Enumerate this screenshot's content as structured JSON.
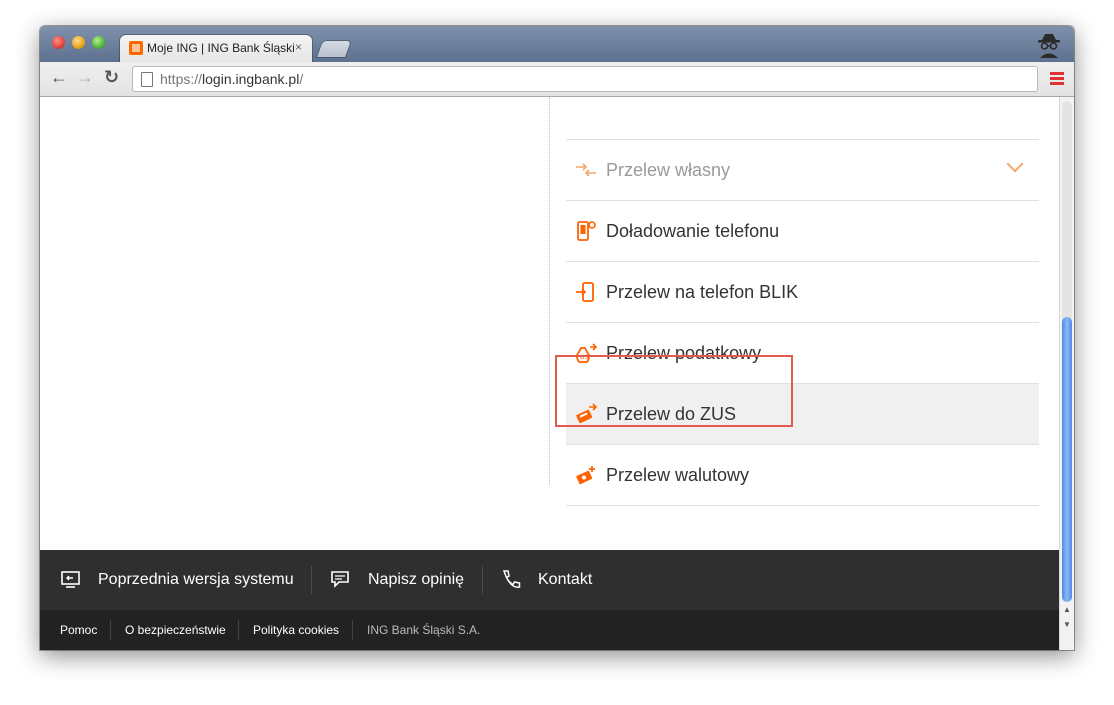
{
  "browser": {
    "tab_title": "Moje ING | ING Bank Śląski",
    "tab_close": "×",
    "url_scheme": "https://",
    "url_host": "login.ingbank.pl",
    "url_path": "/"
  },
  "menu": {
    "items": [
      {
        "label": "Przelew własny",
        "icon": "arrows-exchange-icon"
      },
      {
        "label": "Doładowanie telefonu",
        "icon": "phone-topup-icon"
      },
      {
        "label": "Przelew na telefon BLIK",
        "icon": "phone-blik-icon"
      },
      {
        "label": "Przelew podatkowy",
        "icon": "tax-bag-icon"
      },
      {
        "label": "Przelew do ZUS",
        "icon": "zus-transfer-icon"
      },
      {
        "label": "Przelew walutowy",
        "icon": "currency-transfer-icon"
      }
    ],
    "active_index": 4
  },
  "footer": {
    "top": [
      {
        "label": "Poprzednia wersja systemu",
        "icon": "monitor-icon"
      },
      {
        "label": "Napisz opinię",
        "icon": "chat-icon"
      },
      {
        "label": "Kontakt",
        "icon": "phone-icon"
      }
    ],
    "bottom": {
      "help": "Pomoc",
      "security": "O bezpieczeństwie",
      "cookies": "Polityka cookies",
      "copyright": "ING Bank Śląski S.A."
    }
  },
  "colors": {
    "accent": "#ff6200",
    "highlight": "#e35b4e",
    "footer_dark": "#2f2f2f"
  }
}
